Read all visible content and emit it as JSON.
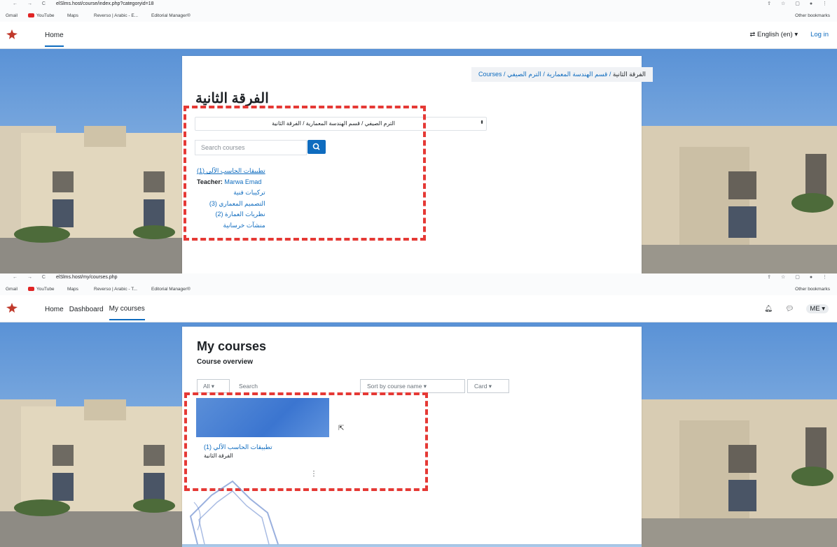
{
  "screen1": {
    "url": "elSlms.host/course/index.php?categoryid=18",
    "bookmarks": [
      "Gmail",
      "YouTube",
      "Maps",
      "Reverso | Arabic - E...",
      "Editorial Manager®"
    ],
    "other_bookmarks": "Other bookmarks",
    "nav": {
      "home": "Home"
    },
    "language": "English (en) ▾",
    "login": "Log in",
    "breadcrumb": {
      "first": "Courses",
      "second": "الترم الصيفي",
      "third": "قسم الهندسة المعمارية",
      "current": "الفرقة الثانية",
      "sep": " / "
    },
    "page_title": "الفرقة الثانية",
    "category_select": "الترم الصيفي / قسم الهندسة المعمارية / الفرقة الثانية",
    "search_placeholder": "Search courses",
    "courses": [
      "تطبيقات الحاسب الآلي (1)",
      "تركيبات فنية",
      "التصميم المعماري (3)",
      "نظريات العمارة (2)",
      "منشآت خرسانية"
    ],
    "teacher_label": "Teacher:",
    "teacher_name": "Marwa Emad"
  },
  "screen2": {
    "url": "elSlms.host/my/courses.php",
    "bookmarks": [
      "Gmail",
      "YouTube",
      "Maps",
      "Reverso | Arabic - T...",
      "Editorial Manager®"
    ],
    "other_bookmarks": "Other bookmarks",
    "nav": {
      "home": "Home",
      "dashboard": "Dashboard",
      "my_courses": "My courses"
    },
    "user_initials": "ME ▾",
    "page_title": "My courses",
    "subtitle": "Course overview",
    "filter_all": "All ▾",
    "search_placeholder": "Search",
    "sort": "Sort by course name ▾",
    "view": "Card ▾",
    "card": {
      "course_name": "تطبيقات الحاسب الآلي (1)",
      "category": "الفرقة الثانية",
      "menu": "⋮"
    }
  },
  "colors": {
    "accent": "#0f6cbf",
    "highlight_box": "#e53935",
    "card": "#3b75d0"
  }
}
